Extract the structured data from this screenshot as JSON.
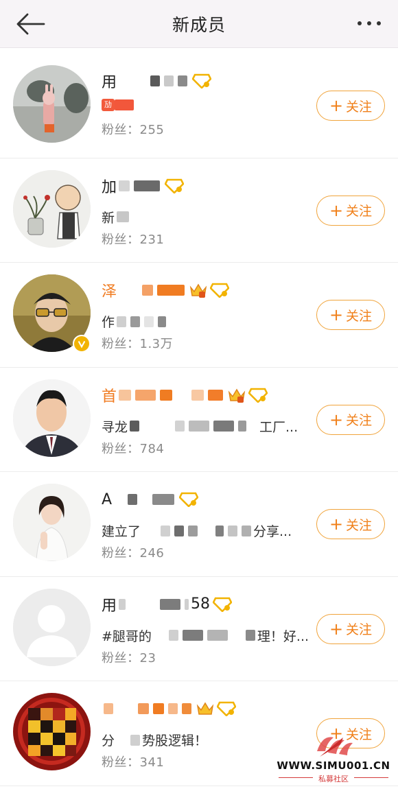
{
  "header": {
    "title": "新成员"
  },
  "follow_label": "关注",
  "members": [
    {
      "name_visible": "用",
      "name_suffix": "",
      "name_color": "dark",
      "desc": "",
      "live_tag": "劢",
      "fans": "粉丝：255",
      "has_crown": false,
      "verified": false,
      "avatar": "garden-sculpture-avatar"
    },
    {
      "name_visible": "加",
      "name_suffix": "",
      "name_color": "dark",
      "desc": "新",
      "live_tag": "",
      "fans": "粉丝：231",
      "has_crown": false,
      "verified": false,
      "avatar": "cartoon-monk-avatar"
    },
    {
      "name_visible": "泽",
      "name_suffix": "",
      "name_color": "orange",
      "desc": "作",
      "live_tag": "",
      "fans": "粉丝：1.3万",
      "has_crown": true,
      "verified": true,
      "avatar": "young-man-glasses-avatar"
    },
    {
      "name_visible": "首",
      "name_suffix": "",
      "name_color": "orange",
      "desc": "寻龙",
      "desc_end": "工厂...",
      "live_tag": "",
      "fans": "粉丝：784",
      "has_crown": true,
      "verified": false,
      "avatar": "man-suit-avatar"
    },
    {
      "name_visible": "A",
      "name_suffix": "",
      "name_color": "dark",
      "desc": "建立了",
      "desc_end": "分享...",
      "live_tag": "",
      "fans": "粉丝：246",
      "has_crown": false,
      "verified": false,
      "avatar": "woman-white-dress-avatar"
    },
    {
      "name_visible": "用",
      "name_suffix": "58",
      "name_color": "dark",
      "desc": "#腿哥的",
      "desc_end": "理！好...",
      "live_tag": "",
      "fans": "粉丝：23",
      "has_crown": false,
      "verified": false,
      "avatar": "default-user-avatar"
    },
    {
      "name_visible": "",
      "name_suffix": "",
      "name_color": "orange",
      "desc": "分",
      "desc_end": "势股逻辑！",
      "live_tag": "",
      "fans": "粉丝：341",
      "has_crown": true,
      "verified": false,
      "avatar": "pixelated-seal-avatar"
    }
  ],
  "watermark": {
    "url": "WWW.SIMU001.CN",
    "sub": "私募社区"
  },
  "colors": {
    "accent": "#f0801a",
    "orange_name": "#f07c22",
    "gem": "#f2b300"
  }
}
